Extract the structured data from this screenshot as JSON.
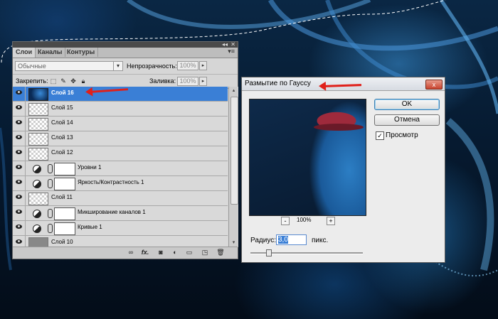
{
  "layers_panel": {
    "tabs": [
      "Слои",
      "Каналы",
      "Контуры"
    ],
    "blend_mode": "Обычные",
    "opacity_label": "Непрозрачность:",
    "opacity_value": "100%",
    "lock_label": "Закрепить:",
    "fill_label": "Заливка:",
    "fill_value": "100%",
    "layers": [
      {
        "name": "Слой 16",
        "kind": "photo",
        "selected": true
      },
      {
        "name": "Слой 15",
        "kind": "pixel"
      },
      {
        "name": "Слой 14",
        "kind": "pixel"
      },
      {
        "name": "Слой 13",
        "kind": "pixel"
      },
      {
        "name": "Слой 12",
        "kind": "pixel"
      },
      {
        "name": "Уровни 1",
        "kind": "adjustment"
      },
      {
        "name": "Яркость/Контрастность 1",
        "kind": "adjustment"
      },
      {
        "name": "Слой 11",
        "kind": "pixel"
      },
      {
        "name": "Микширование каналов 1",
        "kind": "adjustment"
      },
      {
        "name": "Кривые 1",
        "kind": "adjustment"
      },
      {
        "name": "Слой 10",
        "kind": "gray"
      }
    ],
    "bottom_icons": [
      "link-icon",
      "fx-icon",
      "mask-icon",
      "adjustment-icon",
      "folder-icon",
      "new-layer-icon",
      "trash-icon"
    ],
    "fx_label": "fx."
  },
  "dialog": {
    "title": "Размытие по Гауссу",
    "ok_label": "OK",
    "cancel_label": "Отмена",
    "preview_label": "Просмотр",
    "preview_checked": true,
    "zoom_minus": "-",
    "zoom_plus": "+",
    "zoom_value": "100%",
    "radius_label": "Радиус:",
    "radius_value": "3,0",
    "radius_unit": "пикс.",
    "close_label": "x"
  },
  "colors": {
    "selection": "#3a7fd6",
    "arrow": "#e0201a",
    "background": "#0a2744"
  }
}
